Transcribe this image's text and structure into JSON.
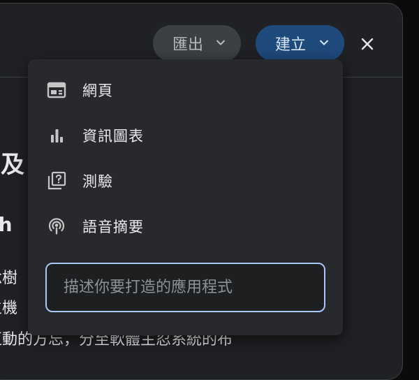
{
  "toolbar": {
    "export_label": "匯出",
    "create_label": "建立"
  },
  "background": {
    "heading_fragment": "及",
    "subheading_fragment": "ch",
    "line1_fragment": "念樹",
    "line2_fragment": "主機",
    "line3_fragment": "互動的方忘，分至軟體主忍系統的布"
  },
  "menu": {
    "items": [
      {
        "label": "網頁",
        "icon": "web-page-icon"
      },
      {
        "label": "資訊圖表",
        "icon": "bar-chart-icon"
      },
      {
        "label": "測驗",
        "icon": "quiz-icon"
      },
      {
        "label": "語音摘要",
        "icon": "podcast-icon"
      }
    ],
    "app_input": {
      "placeholder": "描述你要打造的應用程式",
      "value": ""
    }
  },
  "colors": {
    "window_bg": "#202124",
    "menu_bg": "#28292c",
    "export_bg": "#3c4043",
    "create_bg": "#1f4a7c",
    "input_border": "#a8c7fa",
    "text": "#e8eaed"
  }
}
